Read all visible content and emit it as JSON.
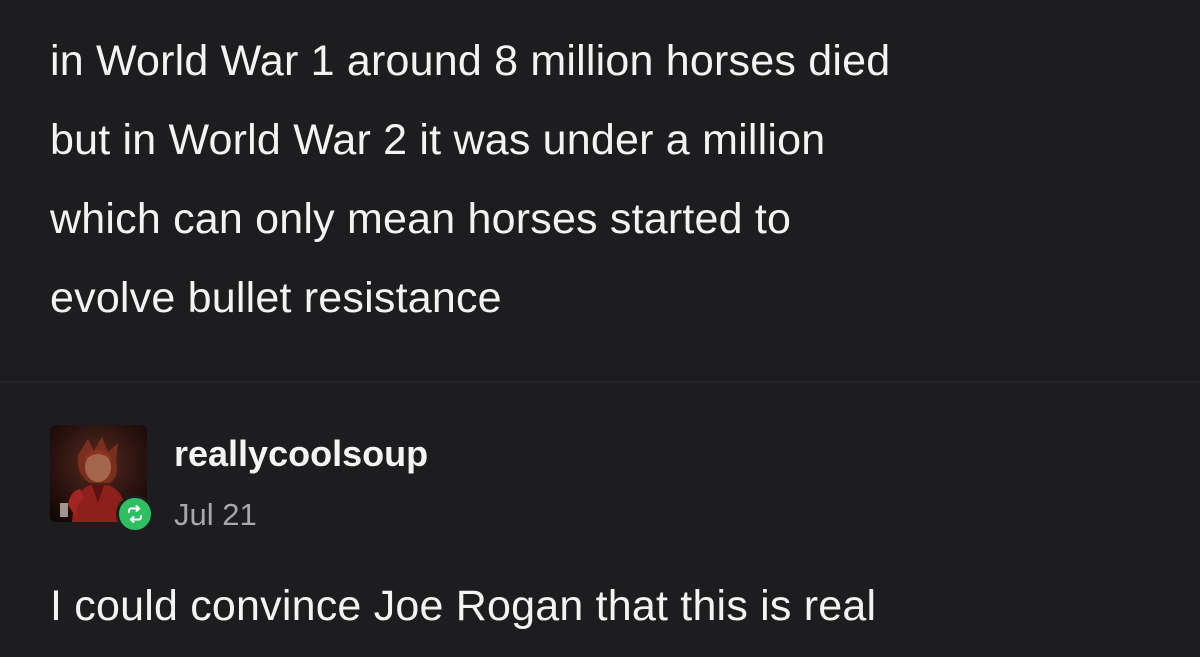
{
  "original_post": {
    "lines": [
      "in World War 1 around 8 million horses died",
      "but in World War 2 it was under a million",
      "which can only mean horses started to",
      "evolve bullet resistance"
    ]
  },
  "reblog": {
    "username": "reallycoolsoup",
    "date": "Jul 21",
    "badge_icon": "reblog-arrows-icon",
    "badge_color": "#2fbf63",
    "text": "I could convince Joe Rogan that this is real"
  }
}
